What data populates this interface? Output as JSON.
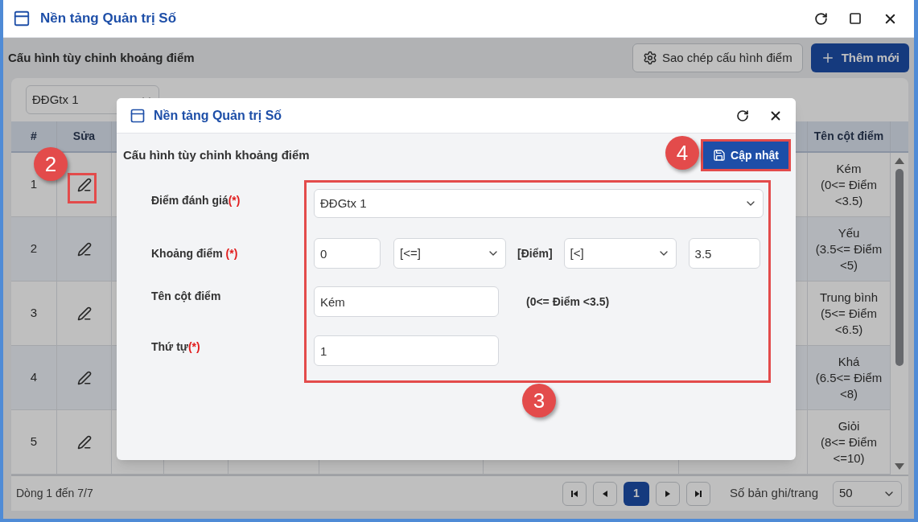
{
  "window": {
    "title": "Nền tảng Quản trị Số"
  },
  "page": {
    "title": "Cấu hình tùy chỉnh khoảng điểm",
    "buttons": [
      {
        "kind": "secondary",
        "label": "Sao chép cấu hình điểm"
      },
      {
        "kind": "primary",
        "label": "Thêm mới"
      }
    ]
  },
  "filter": {
    "value": "ĐĐGtx 1"
  },
  "table": {
    "columns": [
      {
        "label": "#"
      },
      {
        "label": "Sửa"
      },
      {
        "label": "Tên cột điểm"
      }
    ],
    "rows": [
      {
        "index": "1",
        "name_lines": [
          "Kém",
          "(0<= Điểm",
          "<3.5)"
        ]
      },
      {
        "index": "2",
        "name_lines": [
          "Yếu",
          "(3.5<= Điểm",
          "<5)"
        ]
      },
      {
        "index": "3",
        "name_lines": [
          "Trung bình",
          "(5<= Điểm",
          "<6.5)"
        ]
      },
      {
        "index": "4",
        "name_lines": [
          "Khá",
          "(6.5<= Điểm",
          "<8)"
        ]
      },
      {
        "index": "5",
        "name_lines": [
          "Giỏi",
          "(8<= Điểm",
          "<=10)"
        ]
      }
    ]
  },
  "footer": {
    "summary": "Dòng 1 đến 7/7",
    "pages": [
      {
        "label": "1",
        "selected": true
      }
    ],
    "page_size_label": "Số bản ghi/trang",
    "page_size": "50"
  },
  "dialog": {
    "title": "Nền tảng Quản trị Số",
    "heading": "Cấu hình tùy chỉnh khoảng điểm",
    "save_button": "Cập nhật",
    "evaluation": {
      "label": "Điểm đánh giá",
      "required": "(*)",
      "value": "ĐĐGtx 1"
    },
    "range": {
      "label": "Khoảng điểm",
      "required": " (*)",
      "from": "0",
      "from_op": "[<=]",
      "middle": "[Điểm]",
      "to_op": "[<]",
      "to": "3.5"
    },
    "name": {
      "label": "Tên cột điểm",
      "value": "Kém",
      "preview": "(0<= Điểm <3.5)"
    },
    "order": {
      "label": "Thứ tự",
      "required": "(*)",
      "value": "1"
    }
  },
  "callouts": [
    {
      "label": "2"
    },
    {
      "label": "4"
    },
    {
      "label": "3"
    }
  ]
}
